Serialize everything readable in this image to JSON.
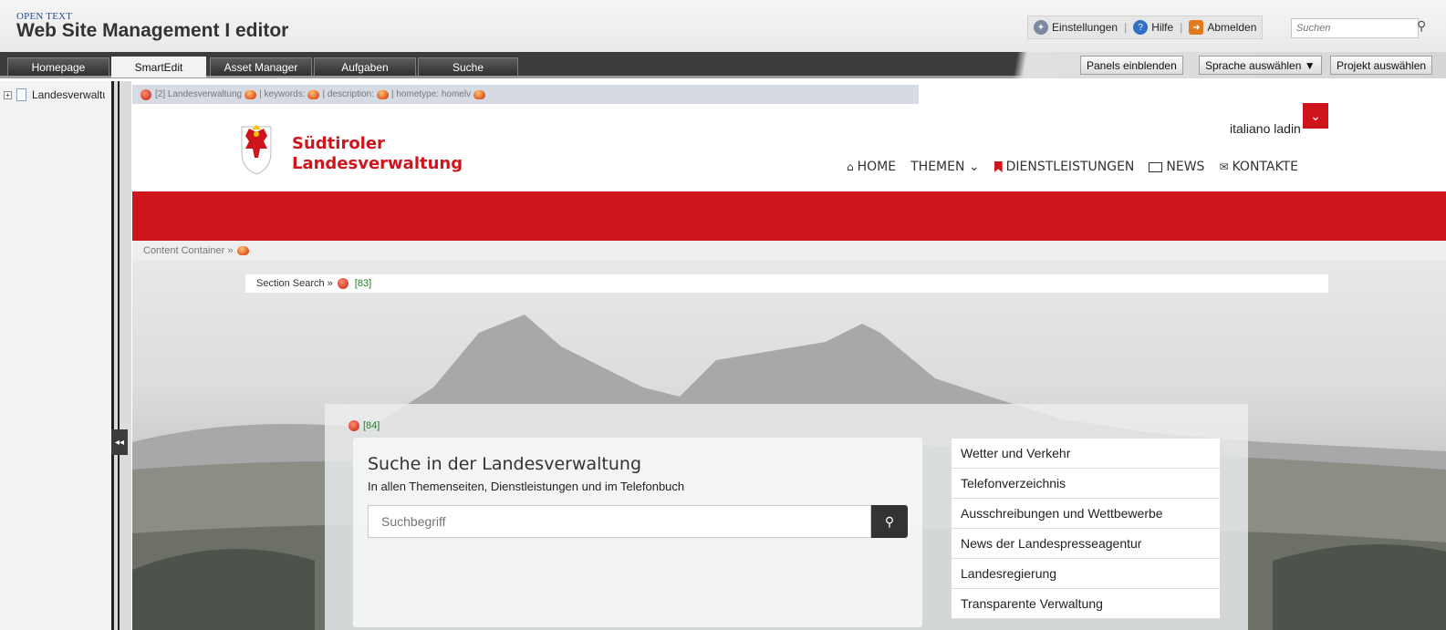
{
  "app": {
    "brand_top": "OPEN TEXT",
    "brand_main": "Web Site Management  I  editor",
    "settings": "Einstellungen",
    "help": "Hilfe",
    "logout": "Abmelden",
    "search_placeholder": "Suchen"
  },
  "tabs": [
    {
      "label": "Homepage"
    },
    {
      "label": "SmartEdit",
      "active": true
    },
    {
      "label": "Asset Manager"
    },
    {
      "label": "Aufgaben"
    },
    {
      "label": "Suche"
    }
  ],
  "toolbar": {
    "panels": "Panels einblenden",
    "language": "Sprache auswählen ▼",
    "project": "Projekt auswählen"
  },
  "tree": {
    "item": "Landesverwaltung"
  },
  "meta": {
    "item1": "[2] Landesverwaltung",
    "item2": "| keywords:",
    "item3": "| description:",
    "item4": "| hometype: homelv"
  },
  "site": {
    "logo_line1": "Südtiroler",
    "logo_line2": "Landesverwaltung",
    "languages": "italiano ladin",
    "nav": [
      {
        "label": "HOME",
        "icon": "home-icon"
      },
      {
        "label": "THEMEN ⌄",
        "icon": ""
      },
      {
        "label": "DIENSTLEISTUNGEN",
        "icon": "bookmark-icon"
      },
      {
        "label": "NEWS",
        "icon": "newspaper-icon"
      },
      {
        "label": "KONTAKTE",
        "icon": "envelope-icon"
      }
    ],
    "content_container": "Content Container »",
    "section_search": "Section Search »",
    "section_id": "[83]",
    "search_id": "[84]",
    "search_title": "Suche in der Landesverwaltung",
    "search_sub": "In allen Themenseiten, Dienstleistungen und im Telefonbuch",
    "search_placeholder": "Suchbegriff",
    "quicklinks": [
      "Wetter und Verkehr",
      "Telefonverzeichnis",
      "Ausschreibungen und Wettbewerbe",
      "News der Landespresseagentur",
      "Landesregierung",
      "Transparente Verwaltung"
    ]
  },
  "colors": {
    "accent": "#d0141c",
    "meta_bar": "#d5dae3",
    "tab_dark": "#3c3c3c"
  }
}
